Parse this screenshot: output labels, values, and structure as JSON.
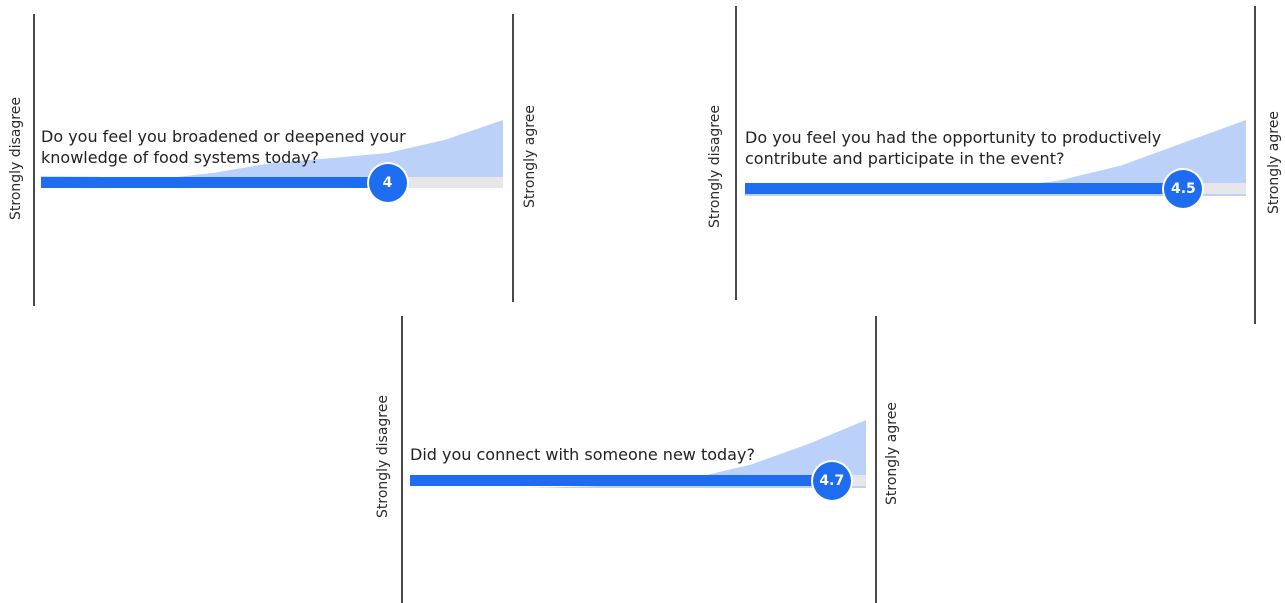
{
  "chart_data": [
    {
      "type": "area",
      "question": "Do you feel you broadened or deepened your knowledge of food systems today?",
      "scale_min_label": "Strongly disagree",
      "scale_max_label": "Strongly agree",
      "average_label": "4",
      "average": 4,
      "scale_range": [
        1,
        5
      ],
      "distribution_x": [
        1,
        1.5,
        2,
        2.5,
        3,
        3.5,
        4,
        4.5,
        5
      ],
      "distribution_y": [
        0.15,
        0.14,
        0.1,
        0.2,
        0.35,
        0.42,
        0.5,
        0.7,
        1.0
      ]
    },
    {
      "type": "area",
      "question": "Do you feel you had the opportunity to productively contribute and participate in the event?",
      "scale_min_label": "Strongly disagree",
      "scale_max_label": "Strongly agree",
      "average_label": "4.5",
      "average": 4.5,
      "scale_range": [
        1,
        5
      ],
      "distribution_x": [
        1,
        1.5,
        2,
        2.5,
        3,
        3.5,
        4,
        4.5,
        5
      ],
      "distribution_y": [
        0.04,
        0.08,
        0.06,
        0.05,
        0.1,
        0.2,
        0.4,
        0.7,
        1.0
      ]
    },
    {
      "type": "area",
      "question": "Did you connect with someone new today?",
      "scale_min_label": "Strongly disagree",
      "scale_max_label": "Strongly agree",
      "average_label": "4.7",
      "average": 4.7,
      "scale_range": [
        1,
        5
      ],
      "distribution_x": [
        1,
        1.5,
        2,
        2.5,
        3,
        3.5,
        4,
        4.5,
        5
      ],
      "distribution_y": [
        0.0,
        0.0,
        0.0,
        0.02,
        0.05,
        0.15,
        0.35,
        0.65,
        1.0
      ]
    }
  ],
  "colors": {
    "bar_fill": "#1e6cf0",
    "distribution_area": "#bcd1fa",
    "track": "#e7e7ea",
    "axis_line": "#4a4a4a"
  }
}
